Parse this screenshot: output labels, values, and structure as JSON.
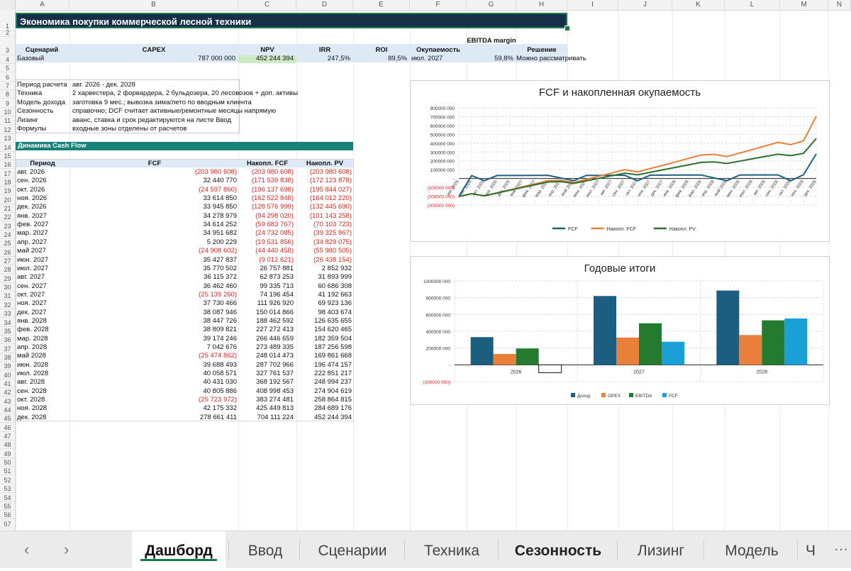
{
  "columns": [
    "A",
    "B",
    "C",
    "D",
    "E",
    "F",
    "G",
    "H",
    "I",
    "J",
    "K",
    "L",
    "M",
    "N"
  ],
  "rows_count": 57,
  "title": "Экономика покупки коммерческой лесной техники",
  "summary": {
    "headers": [
      "Сценарий",
      "CAPEX",
      "NPV",
      "IRR",
      "ROI",
      "Окупаемость",
      "EBITDA margin",
      "Решение"
    ],
    "values": [
      "Базовый",
      "787 000 000",
      "452 244 394",
      "247,5%",
      "89,5%",
      "июл. 2027",
      "59,8%",
      "Можно рассматривать"
    ]
  },
  "info": [
    {
      "label": "Период расчета",
      "value": "авг. 2026 - дек. 2028"
    },
    {
      "label": "Техника",
      "value": "2 харвестера, 2 форвардера, 2 бульдозера, 20 лесовозов + доп. активы"
    },
    {
      "label": "Модель дохода",
      "value": "заготовка 9 мес.; вывозка зима/лето по вводным клиента"
    },
    {
      "label": "Сезонность",
      "value": "справочно; DCF считает активные/ремонтные месяцы напрямую"
    },
    {
      "label": "Лизинг",
      "value": "аванс, ставка и срок редактируются на листе Ввод"
    },
    {
      "label": "Формулы",
      "value": "входные зоны отделены от расчетов"
    }
  ],
  "cashflow": {
    "section_title": "Динамика Cash Flow",
    "headers": [
      "Период",
      "FCF",
      "Накопл. FCF",
      "Накопл. PV"
    ],
    "rows": [
      [
        "авг. 2026",
        "(203 980 608)",
        "(203 980 608)",
        "(203 980 608)"
      ],
      [
        "сен. 2026",
        "32 440 770",
        "(171 539 838)",
        "(172 123 878)"
      ],
      [
        "окт. 2026",
        "(24 597 860)",
        "(196 137 698)",
        "(195 844 027)"
      ],
      [
        "ноя. 2026",
        "33 614 850",
        "(162 522 848)",
        "(164 012 220)"
      ],
      [
        "дек. 2026",
        "33 945 850",
        "(128 576 999)",
        "(132 445 690)"
      ],
      [
        "янв. 2027",
        "34 278 979",
        "(94 298 020)",
        "(101 143 258)"
      ],
      [
        "фев. 2027",
        "34 614 252",
        "(59 683 767)",
        "(70 103 723)"
      ],
      [
        "мар. 2027",
        "34 951 682",
        "(24 732 085)",
        "(39 325 867)"
      ],
      [
        "апр. 2027",
        "5 200 229",
        "(19 531 856)",
        "(34 829 075)"
      ],
      [
        "май 2027",
        "(24 908 602)",
        "(44 440 458)",
        "(55 980 505)"
      ],
      [
        "июн. 2027",
        "35 427 837",
        "(9 012 621)",
        "(26 438 154)"
      ],
      [
        "июл. 2027",
        "35 770 502",
        "26 757 881",
        "2 852 932"
      ],
      [
        "авг. 2027",
        "36 115 372",
        "62 873 253",
        "31 893 999"
      ],
      [
        "сен. 2027",
        "36 462 460",
        "99 335 713",
        "60 686 308"
      ],
      [
        "окт. 2027",
        "(25 139 260)",
        "74 196 454",
        "41 192 663"
      ],
      [
        "ноя. 2027",
        "37 730 466",
        "111 926 920",
        "69 923 136"
      ],
      [
        "дек. 2027",
        "38 087 946",
        "150 014 866",
        "98 403 674"
      ],
      [
        "янв. 2028",
        "38 447 726",
        "188 462 592",
        "126 635 655"
      ],
      [
        "фев. 2028",
        "38 809 821",
        "227 272 413",
        "154 620 465"
      ],
      [
        "мар. 2028",
        "39 174 246",
        "266 446 659",
        "182 359 504"
      ],
      [
        "апр. 2028",
        "7 042 676",
        "273 489 335",
        "187 256 598"
      ],
      [
        "май 2028",
        "(25 474 862)",
        "248 014 473",
        "169 861 668"
      ],
      [
        "июн. 2028",
        "39 688 493",
        "287 702 966",
        "196 474 157"
      ],
      [
        "июл. 2028",
        "40 058 571",
        "327 761 537",
        "222 851 217"
      ],
      [
        "авг. 2028",
        "40 431 030",
        "368 192 567",
        "248 994 237"
      ],
      [
        "сен. 2028",
        "40 805 886",
        "408 998 453",
        "274 904 619"
      ],
      [
        "окт. 2028",
        "(25 723 972)",
        "383 274 481",
        "258 864 815"
      ],
      [
        "ноя. 2028",
        "42 175 332",
        "425 449 813",
        "284 689 176"
      ],
      [
        "дек. 2028",
        "278 661 411",
        "704 111 224",
        "452 244 394"
      ]
    ]
  },
  "chart_data": [
    {
      "type": "line",
      "title": "FCF и накопленная окупаемость",
      "x": [
        "авг. 2026",
        "сен. 2026",
        "окт. 2026",
        "ноя. 2026",
        "дек. 2026",
        "янв. 2027",
        "фев. 2027",
        "мар. 2027",
        "апр. 2027",
        "май 2027",
        "июн. 2027",
        "июл. 2027",
        "авг. 2027",
        "сен. 2027",
        "окт. 2027",
        "ноя. 2027",
        "дек. 2027",
        "янв. 2028",
        "фев. 2028",
        "мар. 2028",
        "апр. 2028",
        "май 2028",
        "июн. 2028",
        "июл. 2028",
        "авг. 2028",
        "сен. 2028",
        "окт. 2028",
        "ноя. 2028",
        "дек. 2028"
      ],
      "y_ticks": [
        "(300000 000)",
        "(200000 000)",
        "(100000 000)",
        "-",
        "100000 000",
        "200000 000",
        "300000 000",
        "400000 000",
        "500000 000",
        "600000 000",
        "700000 000",
        "800000 000"
      ],
      "ylim": [
        -300000000,
        800000000
      ],
      "series": [
        {
          "name": "FCF",
          "color": "#1f5f82",
          "values": [
            -203980608,
            32440770,
            -24597860,
            33614850,
            33945850,
            34278979,
            34614252,
            34951682,
            5200229,
            -24908602,
            35427837,
            35770502,
            36115372,
            36462460,
            -25139260,
            37730466,
            38087946,
            38447726,
            38809821,
            39174246,
            7042676,
            -25474862,
            39688493,
            40058571,
            40431030,
            40805886,
            -25723972,
            42175332,
            278661411
          ]
        },
        {
          "name": "Накопл. FCF",
          "color": "#e8803a",
          "values": [
            -203980608,
            -171539838,
            -196137698,
            -162522848,
            -128576999,
            -94298020,
            -59683767,
            -24732085,
            -19531856,
            -44440458,
            -9012621,
            26757881,
            62873253,
            99335713,
            74196454,
            111926920,
            150014866,
            188462592,
            227272413,
            266446659,
            273489335,
            248014473,
            287702966,
            327761537,
            368192567,
            408998453,
            383274481,
            425449813,
            704111224
          ]
        },
        {
          "name": "Накопл. PV",
          "color": "#2e6e2e",
          "values": [
            -203980608,
            -172123878,
            -195844027,
            -164012220,
            -132445690,
            -101143258,
            -70103723,
            -39325867,
            -34829075,
            -55980505,
            -26438154,
            2852932,
            31893999,
            60686308,
            41192663,
            69923136,
            98403674,
            126635655,
            154620465,
            182359504,
            187256598,
            169861668,
            196474157,
            222851217,
            248994237,
            274904619,
            258864815,
            284689176,
            452244394
          ]
        }
      ],
      "legend": "bottom",
      "grid": true
    },
    {
      "type": "bar",
      "title": "Годовые итоги",
      "categories": [
        "2026",
        "2027",
        "2028"
      ],
      "y_ticks": [
        "(200000 000)",
        "-",
        "200000 000",
        "400000 000",
        "600000 000",
        "800000 000",
        "1000000 000"
      ],
      "ylim": [
        -200000000,
        1000000000
      ],
      "series": [
        {
          "name": "Доход",
          "color": "#1b5e80",
          "values": [
            330000000,
            820000000,
            885000000
          ]
        },
        {
          "name": "OPEX",
          "color": "#e8803a",
          "values": [
            130000000,
            325000000,
            355000000
          ]
        },
        {
          "name": "EBITDA",
          "color": "#247a2e",
          "values": [
            195000000,
            495000000,
            530000000
          ]
        },
        {
          "name": "FCF",
          "color": "#1aa0d8",
          "values": [
            -94000000,
            275000000,
            552000000
          ]
        }
      ],
      "legend": "bottom",
      "grid": true
    }
  ],
  "tabs": {
    "prev": "‹",
    "next": "›",
    "items": [
      "Дашборд",
      "Ввод",
      "Сценарии",
      "Техника",
      "Сезонность",
      "Лизинг",
      "Модель",
      "Ч"
    ],
    "active": "Дашборд",
    "more": "⋯"
  }
}
